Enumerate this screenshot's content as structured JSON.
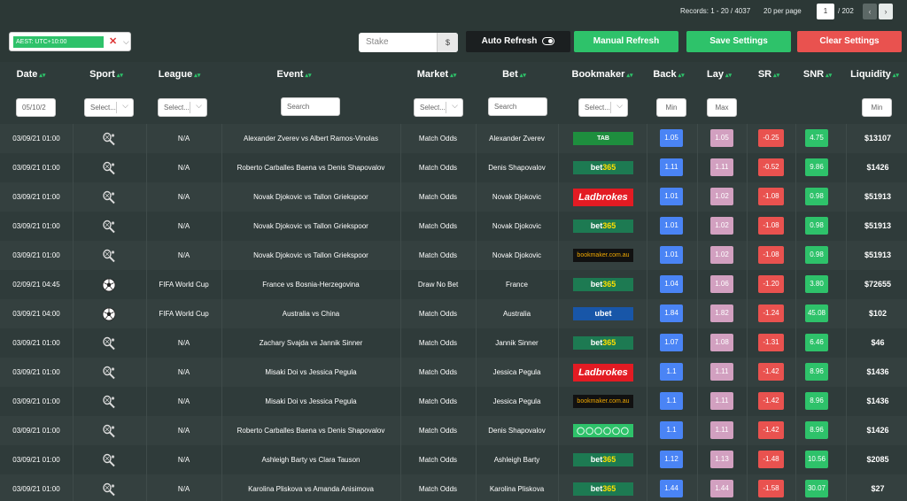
{
  "pagination": {
    "records": "Records: 1 - 20 / 4037",
    "per_page": "20 per page",
    "page": "1",
    "of": "/ 202",
    "prev": "‹",
    "next": "›"
  },
  "toolbar": {
    "timezone": "AEST: UTC+10:00",
    "timezone_clear": "✕",
    "timezone_caret": "⌵",
    "stake_placeholder": "Stake",
    "stake_unit": "$",
    "auto_refresh": "Auto Refresh",
    "manual_refresh": "Manual Refresh",
    "save_settings": "Save Settings",
    "clear_settings": "Clear Settings"
  },
  "columns": [
    "Date",
    "Sport",
    "League",
    "Event",
    "Market",
    "Bet",
    "Bookmaker",
    "Back",
    "Lay",
    "SR",
    "SNR",
    "Liquidity"
  ],
  "filters": {
    "date": "05/10/2",
    "sport": "Select...",
    "league": "Select...",
    "event": "Search",
    "market": "Select...",
    "bet": "Search",
    "bookmaker": "Select...",
    "back": "Min",
    "lay": "Max",
    "liquidity": "Min"
  },
  "colors": {
    "green": "#2ec26a",
    "red": "#e9524f",
    "blue": "#4a84f5",
    "pink": "#d2a0c0",
    "dark": "#1b1f20"
  },
  "rows": [
    {
      "date": "03/09/21 01:00",
      "sport": "tennis-icon",
      "league": "N/A",
      "event": "Alexander Zverev vs Albert Ramos-Vinolas",
      "market": "Match Odds",
      "bet": "Alexander Zverev",
      "bookmaker": "tab",
      "bookmaker_text": "TAB",
      "back": "1.05",
      "lay": "1.05",
      "sr": "-0.25",
      "snr": "4.75",
      "liquidity": "$13107"
    },
    {
      "date": "03/09/21 01:00",
      "sport": "tennis-icon",
      "league": "N/A",
      "event": "Roberto Carballes Baena vs Denis Shapovalov",
      "market": "Match Odds",
      "bet": "Denis Shapovalov",
      "bookmaker": "bet365",
      "bookmaker_text": "bet365",
      "back": "1.11",
      "lay": "1.11",
      "sr": "-0.52",
      "snr": "9.86",
      "liquidity": "$1426"
    },
    {
      "date": "03/09/21 01:00",
      "sport": "tennis-icon",
      "league": "N/A",
      "event": "Novak Djokovic vs Tallon Griekspoor",
      "market": "Match Odds",
      "bet": "Novak Djokovic",
      "bookmaker": "ladbrokes",
      "bookmaker_text": "Ladbrokes",
      "back": "1.01",
      "lay": "1.02",
      "sr": "-1.08",
      "snr": "0.98",
      "liquidity": "$51913"
    },
    {
      "date": "03/09/21 01:00",
      "sport": "tennis-icon",
      "league": "N/A",
      "event": "Novak Djokovic vs Tallon Griekspoor",
      "market": "Match Odds",
      "bet": "Novak Djokovic",
      "bookmaker": "bet365",
      "bookmaker_text": "bet365",
      "back": "1.01",
      "lay": "1.02",
      "sr": "-1.08",
      "snr": "0.98",
      "liquidity": "$51913"
    },
    {
      "date": "03/09/21 01:00",
      "sport": "tennis-icon",
      "league": "N/A",
      "event": "Novak Djokovic vs Tallon Griekspoor",
      "market": "Match Odds",
      "bet": "Novak Djokovic",
      "bookmaker": "bookmaker",
      "bookmaker_text": "bookmaker.com.au",
      "back": "1.01",
      "lay": "1.02",
      "sr": "-1.08",
      "snr": "0.98",
      "liquidity": "$51913"
    },
    {
      "date": "02/09/21 04:45",
      "sport": "soccer-icon",
      "league": "FIFA World Cup",
      "event": "France vs Bosnia-Herzegovina",
      "market": "Draw No Bet",
      "bet": "France",
      "bookmaker": "bet365",
      "bookmaker_text": "bet365",
      "back": "1.04",
      "lay": "1.06",
      "sr": "-1.20",
      "snr": "3.80",
      "liquidity": "$72655"
    },
    {
      "date": "03/09/21 04:00",
      "sport": "soccer-icon",
      "league": "FIFA World Cup",
      "event": "Australia vs China",
      "market": "Match Odds",
      "bet": "Australia",
      "bookmaker": "ubet",
      "bookmaker_text": "ubet",
      "back": "1.84",
      "lay": "1.82",
      "sr": "-1.24",
      "snr": "45.08",
      "liquidity": "$102"
    },
    {
      "date": "03/09/21 01:00",
      "sport": "tennis-icon",
      "league": "N/A",
      "event": "Zachary Svajda vs Jannik Sinner",
      "market": "Match Odds",
      "bet": "Jannik Sinner",
      "bookmaker": "bet365",
      "bookmaker_text": "bet365",
      "back": "1.07",
      "lay": "1.08",
      "sr": "-1.31",
      "snr": "6.46",
      "liquidity": "$46"
    },
    {
      "date": "03/09/21 01:00",
      "sport": "tennis-icon",
      "league": "N/A",
      "event": "Misaki Doi vs Jessica Pegula",
      "market": "Match Odds",
      "bet": "Jessica Pegula",
      "bookmaker": "ladbrokes",
      "bookmaker_text": "Ladbrokes",
      "back": "1.1",
      "lay": "1.11",
      "sr": "-1.42",
      "snr": "8.96",
      "liquidity": "$1436"
    },
    {
      "date": "03/09/21 01:00",
      "sport": "tennis-icon",
      "league": "N/A",
      "event": "Misaki Doi vs Jessica Pegula",
      "market": "Match Odds",
      "bet": "Jessica Pegula",
      "bookmaker": "bookmaker",
      "bookmaker_text": "bookmaker.com.au",
      "back": "1.1",
      "lay": "1.11",
      "sr": "-1.42",
      "snr": "8.96",
      "liquidity": "$1436"
    },
    {
      "date": "03/09/21 01:00",
      "sport": "tennis-icon",
      "league": "N/A",
      "event": "Roberto Carballes Baena vs Denis Shapovalov",
      "market": "Match Odds",
      "bet": "Denis Shapovalov",
      "bookmaker": "sportsbet",
      "bookmaker_text": "",
      "back": "1.1",
      "lay": "1.11",
      "sr": "-1.42",
      "snr": "8.96",
      "liquidity": "$1426"
    },
    {
      "date": "03/09/21 01:00",
      "sport": "tennis-icon",
      "league": "N/A",
      "event": "Ashleigh Barty vs Clara Tauson",
      "market": "Match Odds",
      "bet": "Ashleigh Barty",
      "bookmaker": "bet365",
      "bookmaker_text": "bet365",
      "back": "1.12",
      "lay": "1.13",
      "sr": "-1.48",
      "snr": "10.56",
      "liquidity": "$2085"
    },
    {
      "date": "03/09/21 01:00",
      "sport": "tennis-icon",
      "league": "N/A",
      "event": "Karolina Pliskova vs Amanda Anisimova",
      "market": "Match Odds",
      "bet": "Karolina Pliskova",
      "bookmaker": "bet365",
      "bookmaker_text": "bet365",
      "back": "1.44",
      "lay": "1.44",
      "sr": "-1.58",
      "snr": "30.07",
      "liquidity": "$27"
    }
  ]
}
